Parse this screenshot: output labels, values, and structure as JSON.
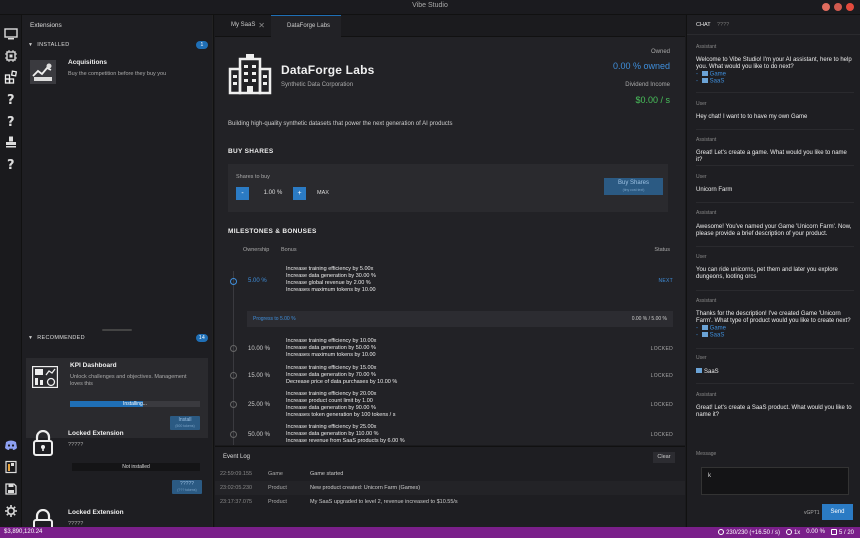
{
  "window": {
    "title": "Vibe Studio"
  },
  "extensions": {
    "header": "Extensions",
    "installed_label": "INSTALLED",
    "installed_count": "1",
    "installed": [
      {
        "name": "Acquisitions",
        "desc": "Buy the competition before they buy you"
      }
    ],
    "recommended_label": "RECOMMENDED",
    "recommended_count": "14",
    "recommended": [
      {
        "name": "KPI Dashboard",
        "desc": "Unlock challenges and objectives. Management loves this",
        "progress_label": "Installing...",
        "progress": 0.56,
        "button": "Install",
        "button_sub": "(500 tokens)"
      },
      {
        "name": "Locked Extension",
        "desc": "?????",
        "status": "Not installed",
        "button": "?????",
        "button_sub": "(??? tokens)"
      },
      {
        "name": "Locked Extension",
        "desc": "?????"
      }
    ]
  },
  "tabs": [
    {
      "label": "My SaaS"
    },
    {
      "label": "DataForge Labs"
    }
  ],
  "company": {
    "name": "DataForge Labs",
    "subtitle": "Synthetic Data Corporation",
    "owned_label": "Owned",
    "owned_value": "0.00 % owned",
    "dividend_label": "Dividend Income",
    "dividend_value": "$0.00 / s",
    "tagline": "Building high-quality synthetic datasets that power the next generation of AI products"
  },
  "buy": {
    "heading": "BUY SHARES",
    "label": "Shares to buy",
    "value": "1.00 %",
    "minus": "-",
    "plus": "+",
    "max": "MAX",
    "button": "Buy Shares",
    "button_sub": "(tiny cost text)"
  },
  "milestones": {
    "heading": "MILESTONES & BONUSES",
    "col_ownership": "Ownership",
    "col_bonus": "Bonus",
    "col_status": "Status",
    "progress_left": "Progress to 5.00 %",
    "progress_right": "0.00 % / 5.00 %",
    "rows": [
      {
        "pct": "5.00 %",
        "status": "NEXT",
        "bonuses": [
          "Increase training efficiency by 5.00x",
          "Increase data generation by 30.00 %",
          "Increase global revenue by 2.00 %",
          "Increases maximum tokens by 10.00"
        ]
      },
      {
        "pct": "10.00 %",
        "status": "LOCKED",
        "bonuses": [
          "Increase training efficiency by 10.00x",
          "Increase data generation by 50.00 %",
          "Increases maximum tokens by 10.00"
        ]
      },
      {
        "pct": "15.00 %",
        "status": "LOCKED",
        "bonuses": [
          "Increase training efficiency by 15.00x",
          "Increase data generation by 70.00 %",
          "Decrease price of data purchases by 10.00 %"
        ]
      },
      {
        "pct": "25.00 %",
        "status": "LOCKED",
        "bonuses": [
          "Increase training efficiency by 20.00x",
          "Increase product count limit by 1.00",
          "Increase data generation by 90.00 %",
          "Increases token generation by 100 tokens / s"
        ]
      },
      {
        "pct": "50.00 %",
        "status": "LOCKED",
        "bonuses": [
          "Increase training efficiency by 25.00x",
          "Increase data generation by 110.00 %",
          "Increase revenue from SaaS products by 6.00 %"
        ]
      }
    ]
  },
  "eventlog": {
    "title": "Event Log",
    "clear": "Clear",
    "rows": [
      {
        "time": "22:59:09.155",
        "cat": "Game",
        "msg": "Game started"
      },
      {
        "time": "23:02:05.230",
        "cat": "Product",
        "msg": "New product created: Unicorn Farm (Games)"
      },
      {
        "time": "23:17:37.075",
        "cat": "Product",
        "msg": "My SaaS upgraded to level 2, revenue increased to $10.55/s"
      }
    ]
  },
  "chat": {
    "tab_chat": "CHAT",
    "tab_other": "????",
    "messages": [
      {
        "role": "Assistant",
        "text": "Welcome to Vibe Studio! I'm your AI assistant, here to help you. What would you like to do next?",
        "links": [
          "Game",
          "SaaS"
        ]
      },
      {
        "role": "User",
        "text": "Hey chat! I want to to have my own Game"
      },
      {
        "role": "Assistant",
        "text": "Great! Let's create a game. What would you like to name it?"
      },
      {
        "role": "User",
        "text": "Unicorn Farm"
      },
      {
        "role": "Assistant",
        "text": "Awesome! You've named your Game 'Unicorn Farm'. Now, please provide a brief description of your product."
      },
      {
        "role": "User",
        "text": "You can ride unicorns, pet them and later you explore dungeons, looting orcs"
      },
      {
        "role": "Assistant",
        "text": "Thanks for the description! I've created Game 'Unicorn Farm'. What type of product would you like to create next?",
        "links": [
          "Game",
          "SaaS"
        ]
      },
      {
        "role": "User",
        "text": "SaaS"
      },
      {
        "role": "Assistant",
        "text": "Great! Let's create a SaaS product. What would you like to name it?"
      }
    ],
    "message_label": "Message",
    "input_value": "k",
    "model": "vGPT1",
    "send": "Send"
  },
  "statusbar": {
    "money": "$3,890,120.24",
    "tokens": "230/230 (+16.50 / s)",
    "multiplier": "1x",
    "share": "0.00 %",
    "products": "5 / 20"
  },
  "colors": {
    "accent": "#1f6fb6",
    "positive": "#49c05b",
    "statusbar": "#7a1f8a"
  }
}
